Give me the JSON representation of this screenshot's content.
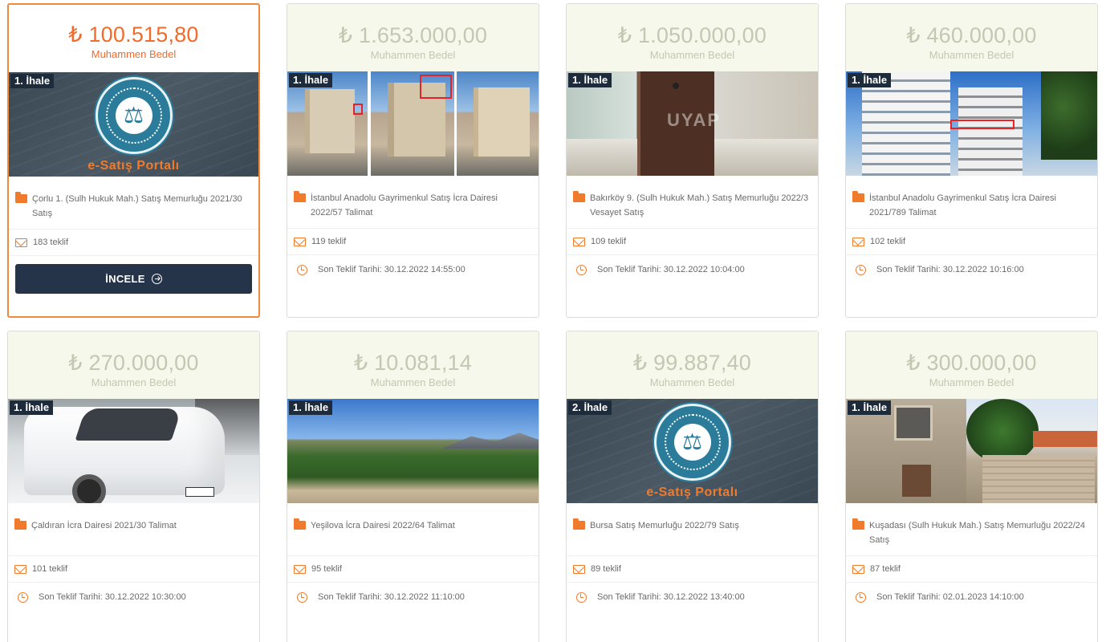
{
  "currency_symbol": "₺",
  "price_caption": "Muhammen Bedel",
  "inspect_button_label": "İNCELE",
  "portal_image_text": "e-Satış Portalı",
  "deadline_prefix": "Son Teklif Tarihi:",
  "colors": {
    "accent": "#f07b2d",
    "price_active": "#f26b2a",
    "price_muted": "#c4c8b2",
    "button": "#26344a",
    "badge": "#1d2b3b"
  },
  "listings": [
    {
      "price": "100.515,80",
      "badge": "1. İhale",
      "image": "e-satis-portal-logo",
      "title": "Çorlu 1. (Sulh Hukuk Mah.) Satış Memurluğu 2021/30 Satış",
      "offers": "183 teklif",
      "deadline": "",
      "active": true
    },
    {
      "price": "1.653.000,00",
      "badge": "1. İhale",
      "image": "apartment-buildings-photo",
      "title": "İstanbul Anadolu Gayrimenkul Satış İcra Dairesi 2022/57 Talimat",
      "offers": "119 teklif",
      "deadline": "30.12.2022 14:55:00",
      "active": false
    },
    {
      "price": "1.050.000,00",
      "badge": "1. İhale",
      "image": "interior-door-photo",
      "title": "Bakırköy 9. (Sulh Hukuk Mah.) Satış Memurluğu 2022/3 Vesayet Satış",
      "offers": "109 teklif",
      "deadline": "30.12.2022 10:04:00",
      "active": false
    },
    {
      "price": "460.000,00",
      "badge": "1. İhale",
      "image": "apartment-tower-photo",
      "title": "İstanbul Anadolu Gayrimenkul Satış İcra Dairesi 2021/789 Talimat",
      "offers": "102 teklif",
      "deadline": "30.12.2022 10:16:00",
      "active": false
    },
    {
      "price": "270.000,00",
      "badge": "1. İhale",
      "image": "white-van-photo",
      "title": "Çaldıran İcra Dairesi 2021/30 Talimat",
      "offers": "101 teklif",
      "deadline": "30.12.2022 10:30:00",
      "active": false
    },
    {
      "price": "10.081,14",
      "badge": "1. İhale",
      "image": "orchard-field-photo",
      "title": "Yeşilova İcra Dairesi 2022/64 Talimat",
      "offers": "95 teklif",
      "deadline": "30.12.2022 11:10:00",
      "active": false
    },
    {
      "price": "99.887,40",
      "badge": "2. İhale",
      "image": "e-satis-portal-logo",
      "title": "Bursa Satış Memurluğu 2022/79 Satış",
      "offers": "89 teklif",
      "deadline": "30.12.2022 13:40:00",
      "active": false
    },
    {
      "price": "300.000,00",
      "badge": "1. İhale",
      "image": "old-house-photo",
      "title": "Kuşadası (Sulh Hukuk Mah.) Satış Memurluğu 2022/24 Satış",
      "offers": "87 teklif",
      "deadline": "02.01.2023 14:10:00",
      "active": false
    }
  ]
}
